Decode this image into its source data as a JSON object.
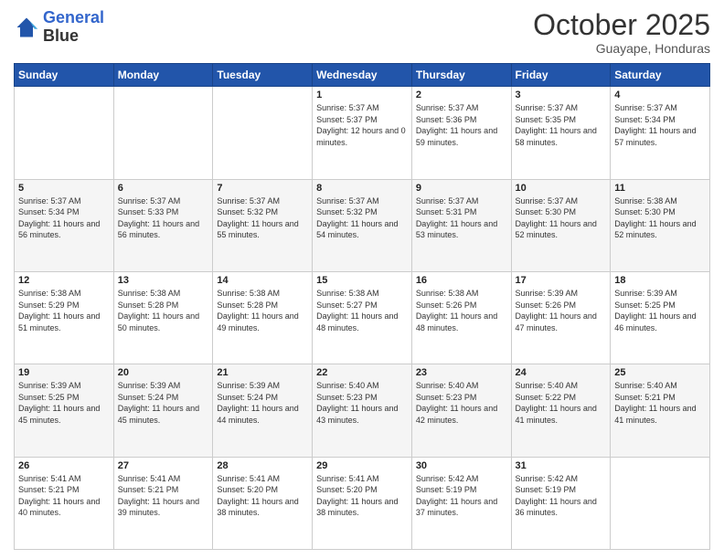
{
  "header": {
    "logo_line1": "General",
    "logo_line2": "Blue",
    "month_title": "October 2025",
    "subtitle": "Guayape, Honduras"
  },
  "weekdays": [
    "Sunday",
    "Monday",
    "Tuesday",
    "Wednesday",
    "Thursday",
    "Friday",
    "Saturday"
  ],
  "weeks": [
    [
      {
        "day": "",
        "sunrise": "",
        "sunset": "",
        "daylight": ""
      },
      {
        "day": "",
        "sunrise": "",
        "sunset": "",
        "daylight": ""
      },
      {
        "day": "",
        "sunrise": "",
        "sunset": "",
        "daylight": ""
      },
      {
        "day": "1",
        "sunrise": "Sunrise: 5:37 AM",
        "sunset": "Sunset: 5:37 PM",
        "daylight": "Daylight: 12 hours and 0 minutes."
      },
      {
        "day": "2",
        "sunrise": "Sunrise: 5:37 AM",
        "sunset": "Sunset: 5:36 PM",
        "daylight": "Daylight: 11 hours and 59 minutes."
      },
      {
        "day": "3",
        "sunrise": "Sunrise: 5:37 AM",
        "sunset": "Sunset: 5:35 PM",
        "daylight": "Daylight: 11 hours and 58 minutes."
      },
      {
        "day": "4",
        "sunrise": "Sunrise: 5:37 AM",
        "sunset": "Sunset: 5:34 PM",
        "daylight": "Daylight: 11 hours and 57 minutes."
      }
    ],
    [
      {
        "day": "5",
        "sunrise": "Sunrise: 5:37 AM",
        "sunset": "Sunset: 5:34 PM",
        "daylight": "Daylight: 11 hours and 56 minutes."
      },
      {
        "day": "6",
        "sunrise": "Sunrise: 5:37 AM",
        "sunset": "Sunset: 5:33 PM",
        "daylight": "Daylight: 11 hours and 56 minutes."
      },
      {
        "day": "7",
        "sunrise": "Sunrise: 5:37 AM",
        "sunset": "Sunset: 5:32 PM",
        "daylight": "Daylight: 11 hours and 55 minutes."
      },
      {
        "day": "8",
        "sunrise": "Sunrise: 5:37 AM",
        "sunset": "Sunset: 5:32 PM",
        "daylight": "Daylight: 11 hours and 54 minutes."
      },
      {
        "day": "9",
        "sunrise": "Sunrise: 5:37 AM",
        "sunset": "Sunset: 5:31 PM",
        "daylight": "Daylight: 11 hours and 53 minutes."
      },
      {
        "day": "10",
        "sunrise": "Sunrise: 5:37 AM",
        "sunset": "Sunset: 5:30 PM",
        "daylight": "Daylight: 11 hours and 52 minutes."
      },
      {
        "day": "11",
        "sunrise": "Sunrise: 5:38 AM",
        "sunset": "Sunset: 5:30 PM",
        "daylight": "Daylight: 11 hours and 52 minutes."
      }
    ],
    [
      {
        "day": "12",
        "sunrise": "Sunrise: 5:38 AM",
        "sunset": "Sunset: 5:29 PM",
        "daylight": "Daylight: 11 hours and 51 minutes."
      },
      {
        "day": "13",
        "sunrise": "Sunrise: 5:38 AM",
        "sunset": "Sunset: 5:28 PM",
        "daylight": "Daylight: 11 hours and 50 minutes."
      },
      {
        "day": "14",
        "sunrise": "Sunrise: 5:38 AM",
        "sunset": "Sunset: 5:28 PM",
        "daylight": "Daylight: 11 hours and 49 minutes."
      },
      {
        "day": "15",
        "sunrise": "Sunrise: 5:38 AM",
        "sunset": "Sunset: 5:27 PM",
        "daylight": "Daylight: 11 hours and 48 minutes."
      },
      {
        "day": "16",
        "sunrise": "Sunrise: 5:38 AM",
        "sunset": "Sunset: 5:26 PM",
        "daylight": "Daylight: 11 hours and 48 minutes."
      },
      {
        "day": "17",
        "sunrise": "Sunrise: 5:39 AM",
        "sunset": "Sunset: 5:26 PM",
        "daylight": "Daylight: 11 hours and 47 minutes."
      },
      {
        "day": "18",
        "sunrise": "Sunrise: 5:39 AM",
        "sunset": "Sunset: 5:25 PM",
        "daylight": "Daylight: 11 hours and 46 minutes."
      }
    ],
    [
      {
        "day": "19",
        "sunrise": "Sunrise: 5:39 AM",
        "sunset": "Sunset: 5:25 PM",
        "daylight": "Daylight: 11 hours and 45 minutes."
      },
      {
        "day": "20",
        "sunrise": "Sunrise: 5:39 AM",
        "sunset": "Sunset: 5:24 PM",
        "daylight": "Daylight: 11 hours and 45 minutes."
      },
      {
        "day": "21",
        "sunrise": "Sunrise: 5:39 AM",
        "sunset": "Sunset: 5:24 PM",
        "daylight": "Daylight: 11 hours and 44 minutes."
      },
      {
        "day": "22",
        "sunrise": "Sunrise: 5:40 AM",
        "sunset": "Sunset: 5:23 PM",
        "daylight": "Daylight: 11 hours and 43 minutes."
      },
      {
        "day": "23",
        "sunrise": "Sunrise: 5:40 AM",
        "sunset": "Sunset: 5:23 PM",
        "daylight": "Daylight: 11 hours and 42 minutes."
      },
      {
        "day": "24",
        "sunrise": "Sunrise: 5:40 AM",
        "sunset": "Sunset: 5:22 PM",
        "daylight": "Daylight: 11 hours and 41 minutes."
      },
      {
        "day": "25",
        "sunrise": "Sunrise: 5:40 AM",
        "sunset": "Sunset: 5:21 PM",
        "daylight": "Daylight: 11 hours and 41 minutes."
      }
    ],
    [
      {
        "day": "26",
        "sunrise": "Sunrise: 5:41 AM",
        "sunset": "Sunset: 5:21 PM",
        "daylight": "Daylight: 11 hours and 40 minutes."
      },
      {
        "day": "27",
        "sunrise": "Sunrise: 5:41 AM",
        "sunset": "Sunset: 5:21 PM",
        "daylight": "Daylight: 11 hours and 39 minutes."
      },
      {
        "day": "28",
        "sunrise": "Sunrise: 5:41 AM",
        "sunset": "Sunset: 5:20 PM",
        "daylight": "Daylight: 11 hours and 38 minutes."
      },
      {
        "day": "29",
        "sunrise": "Sunrise: 5:41 AM",
        "sunset": "Sunset: 5:20 PM",
        "daylight": "Daylight: 11 hours and 38 minutes."
      },
      {
        "day": "30",
        "sunrise": "Sunrise: 5:42 AM",
        "sunset": "Sunset: 5:19 PM",
        "daylight": "Daylight: 11 hours and 37 minutes."
      },
      {
        "day": "31",
        "sunrise": "Sunrise: 5:42 AM",
        "sunset": "Sunset: 5:19 PM",
        "daylight": "Daylight: 11 hours and 36 minutes."
      },
      {
        "day": "",
        "sunrise": "",
        "sunset": "",
        "daylight": ""
      }
    ]
  ]
}
